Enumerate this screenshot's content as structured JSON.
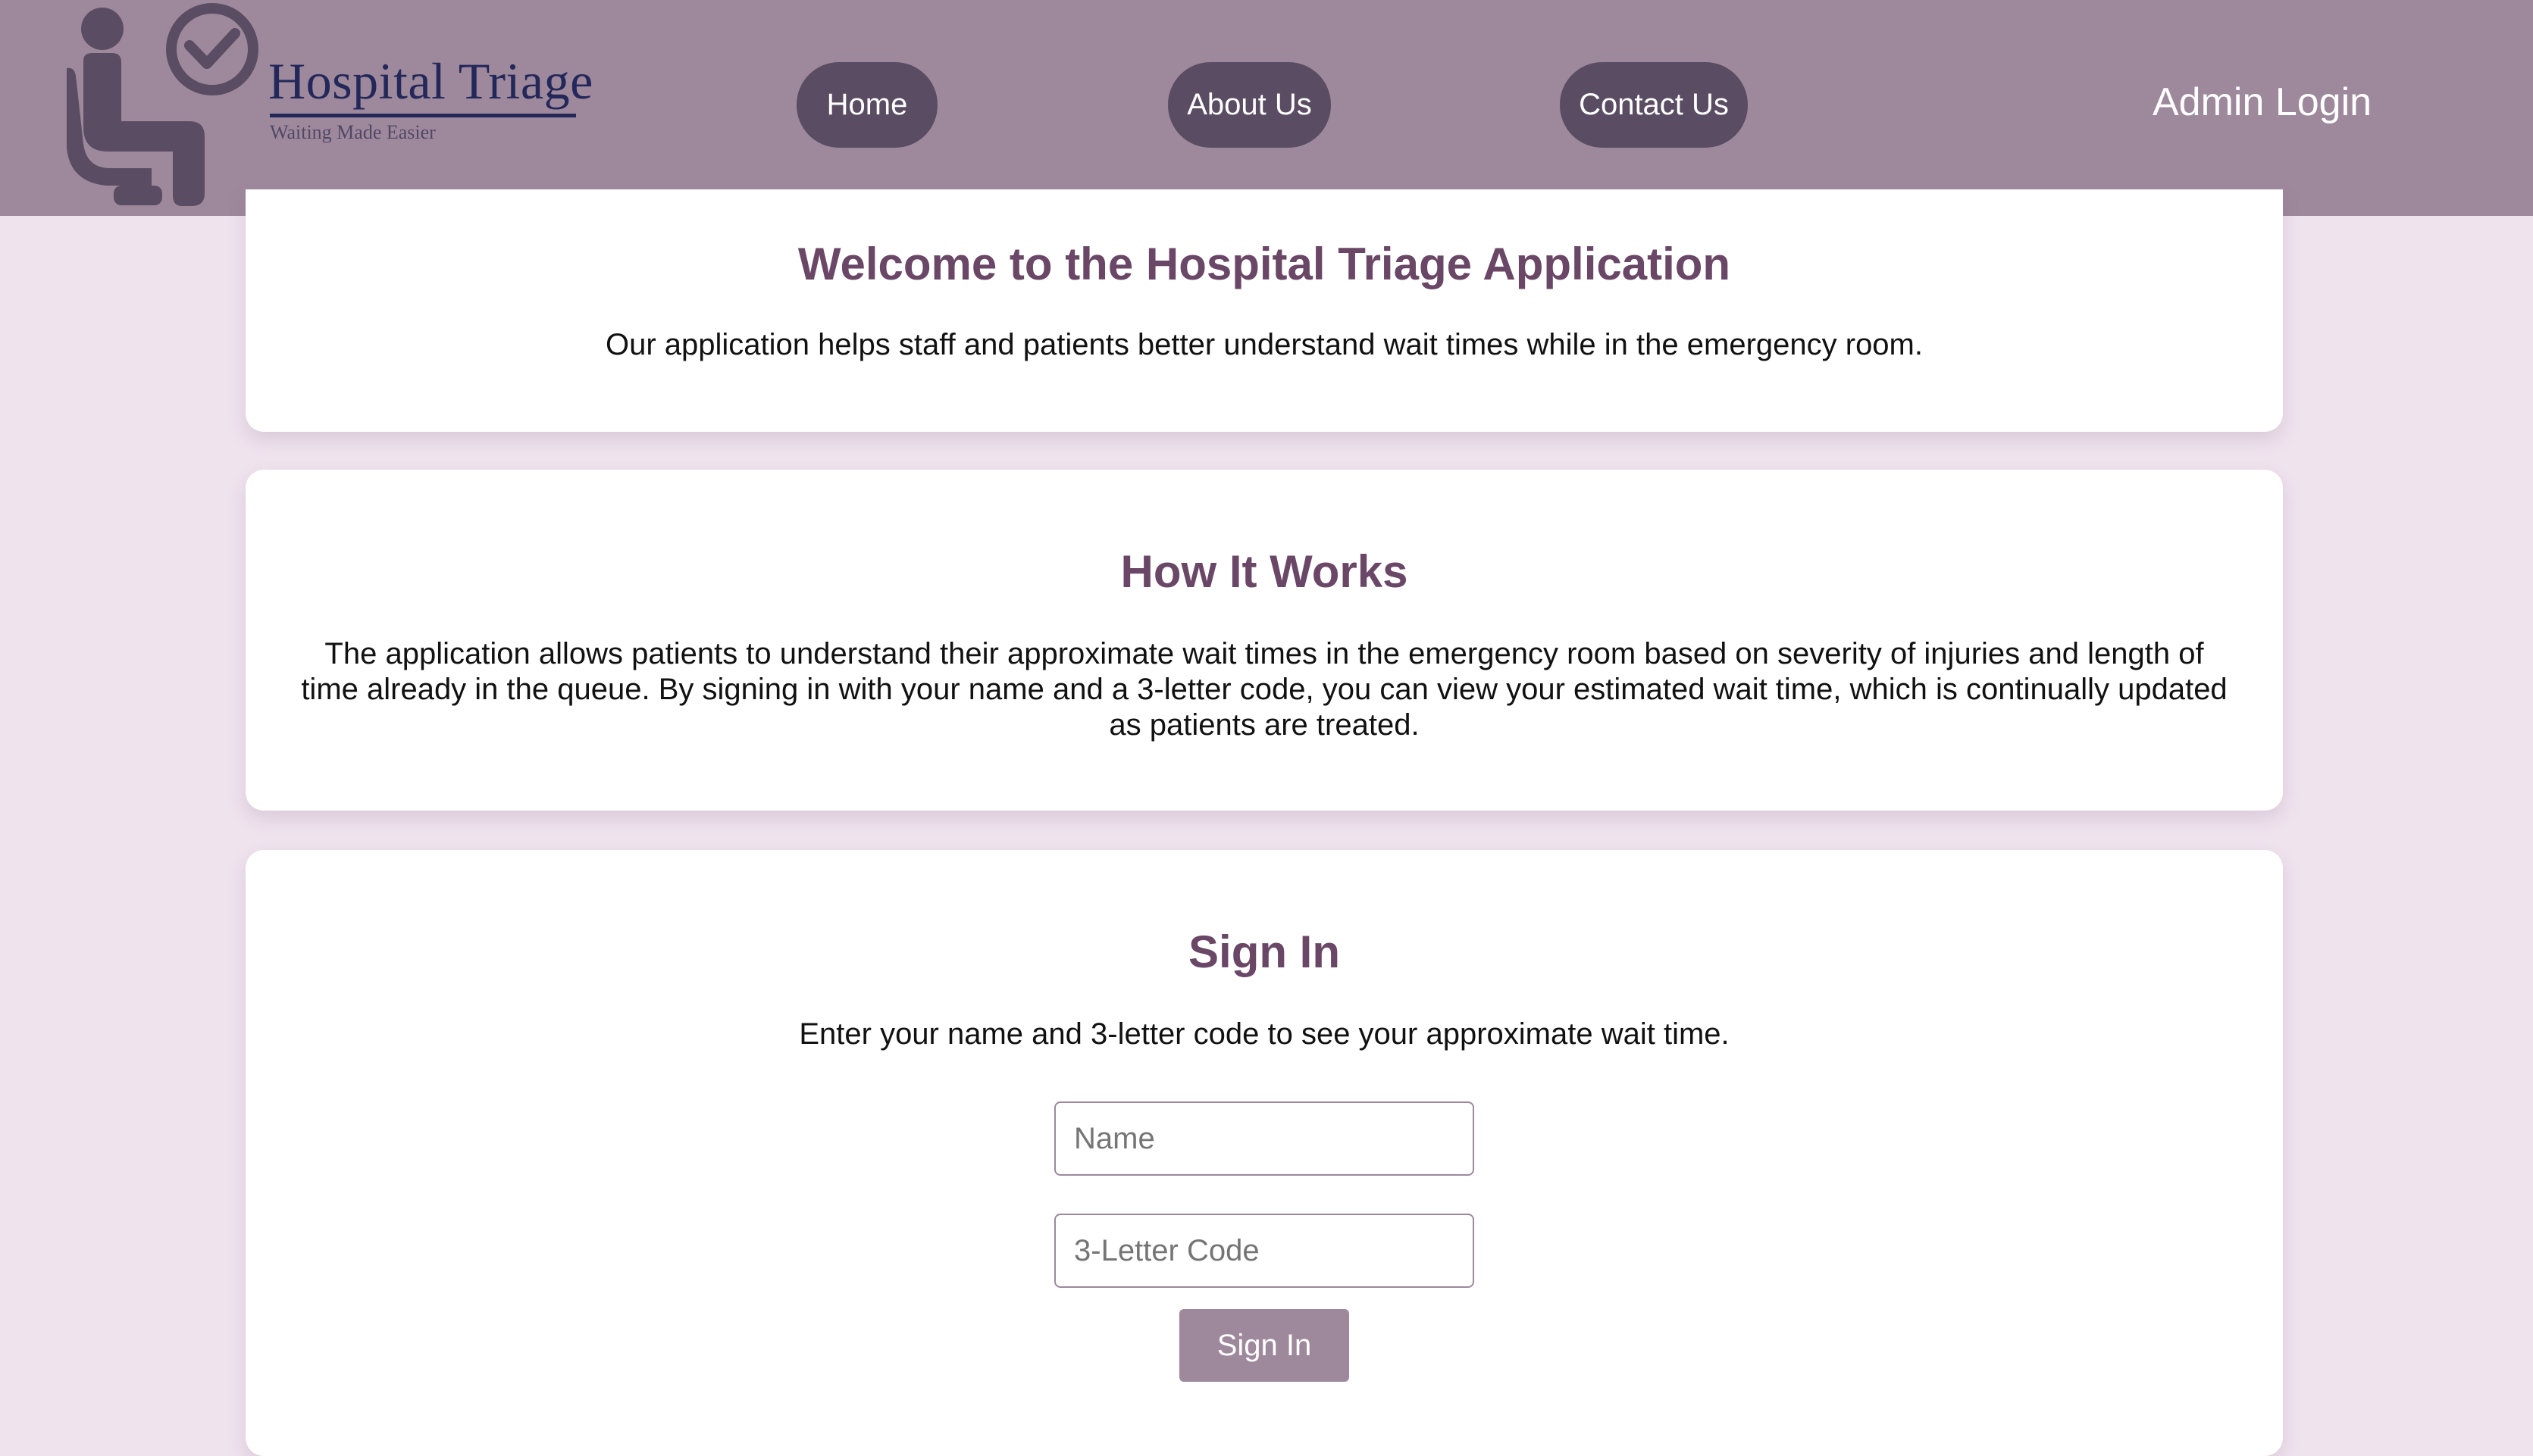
{
  "header": {
    "logo": {
      "title": "Hospital Triage",
      "tagline": "Waiting Made Easier",
      "icon": "waiting-patient-clock-icon"
    },
    "nav": {
      "home": "Home",
      "about": "About Us",
      "contact": "Contact Us"
    },
    "admin_login": "Admin Login"
  },
  "welcome": {
    "title": "Welcome to the Hospital Triage Application",
    "text": "Our application helps staff and patients better understand wait times while in the emergency room."
  },
  "how_it_works": {
    "title": "How It Works",
    "text": "The application allows patients to understand their approximate wait times in the emergency room based on severity of injuries and length of time already in the queue. By signing in with your name and a 3-letter code, you can view your estimated wait time, which is continually updated as patients are treated."
  },
  "sign_in": {
    "title": "Sign In",
    "text": "Enter your name and 3-letter code to see your approximate wait time.",
    "name_placeholder": "Name",
    "name_value": "",
    "code_placeholder": "3-Letter Code",
    "code_value": "",
    "button_label": "Sign In"
  },
  "colors": {
    "header_bg": "#9e889c",
    "nav_button_bg": "#5a4d63",
    "page_bg": "#efe3ee",
    "heading": "#6a4766",
    "logo_text": "#23285a"
  }
}
